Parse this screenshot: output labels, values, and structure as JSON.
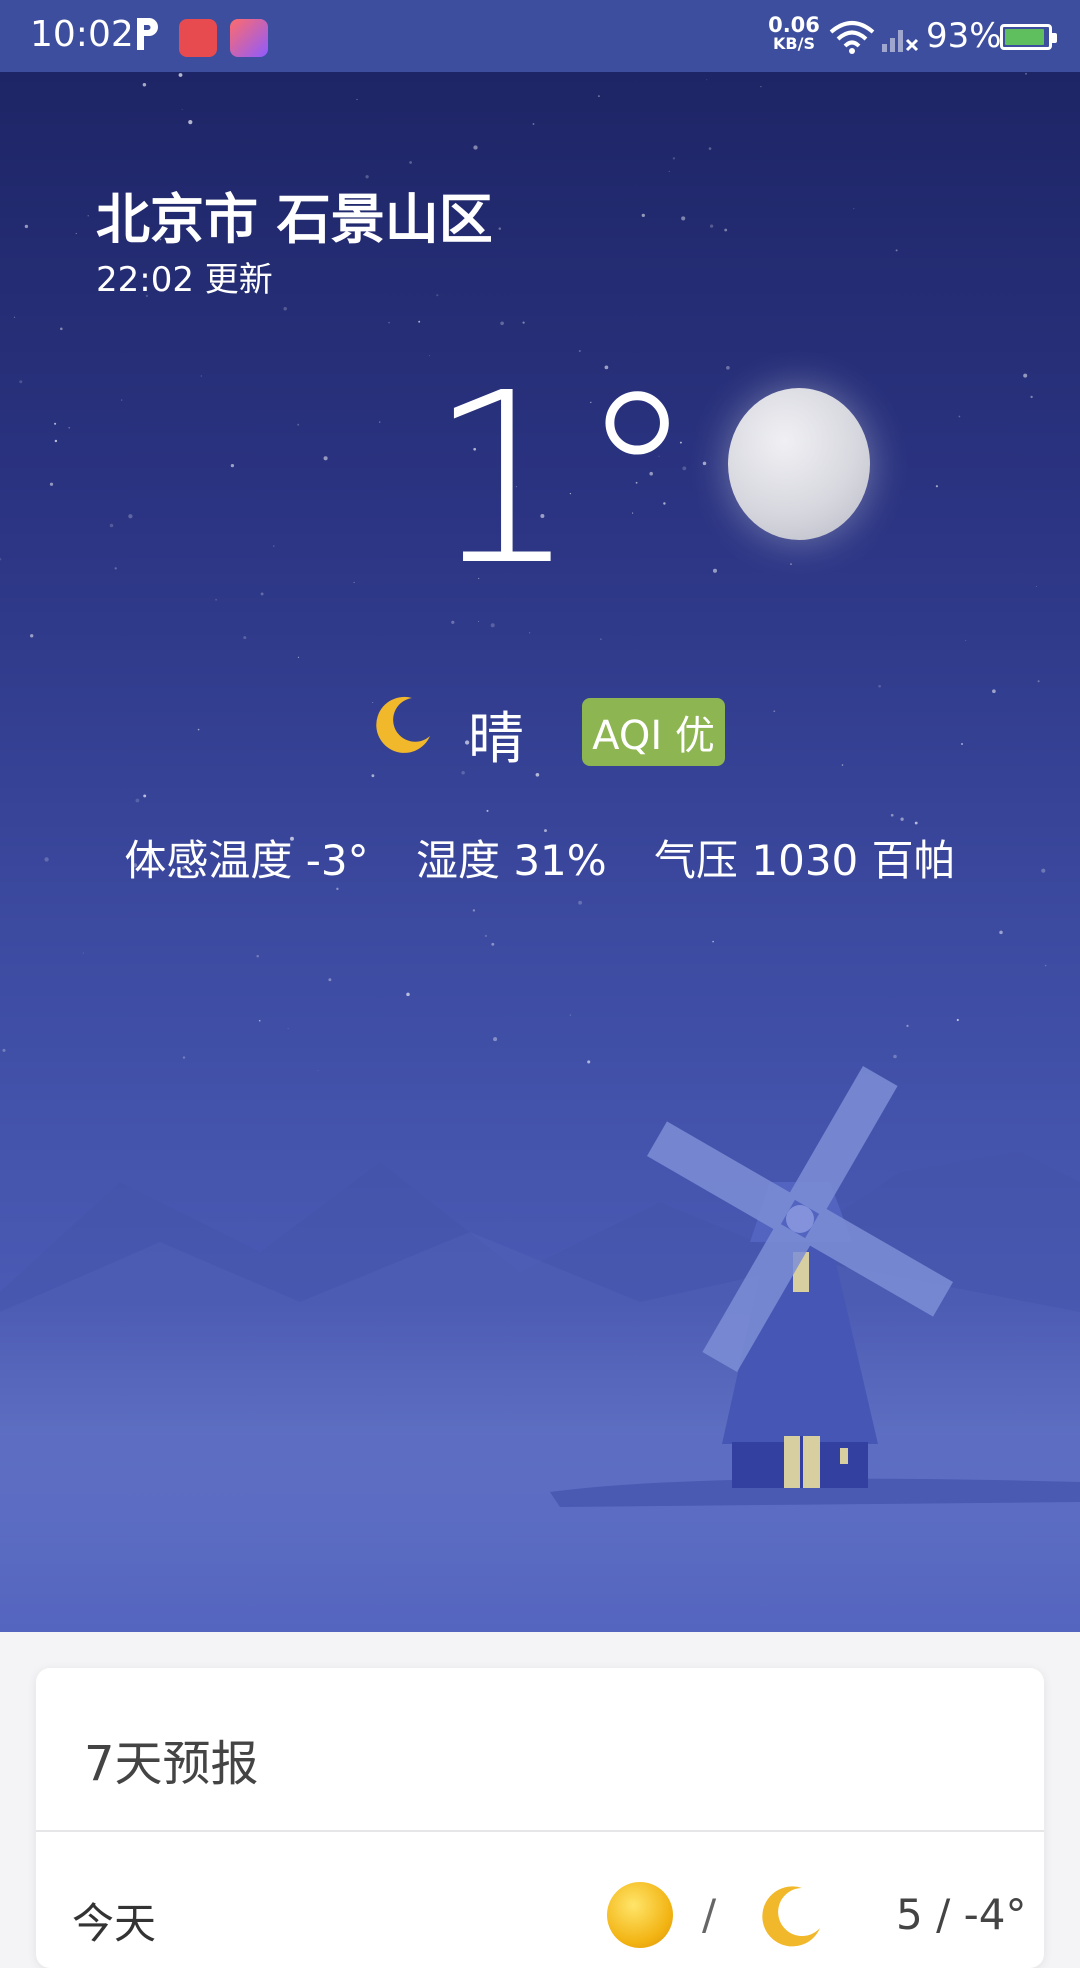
{
  "status_bar": {
    "time": "10:02",
    "net_speed_value": "0.06",
    "net_speed_unit": "KB/S",
    "battery_percent": "93%",
    "battery_level": 0.93,
    "icons": [
      "parking-icon",
      "red-app-icon",
      "paint-app-icon",
      "wifi-icon",
      "signal-icon",
      "battery-icon"
    ]
  },
  "weather": {
    "location": "北京市 石景山区",
    "updated": "22:02 更新",
    "temperature": "1°",
    "condition": "晴",
    "condition_icon": "crescent-moon-icon",
    "aqi": "AQI 优",
    "aqi_color": "#8db551",
    "feels_like": "体感温度 -3°",
    "humidity": "湿度 31%",
    "pressure": "气压 1030 百帕"
  },
  "forecast": {
    "title": "7天预报",
    "days": [
      {
        "name": "今天",
        "day_icon": "sun-icon",
        "night_icon": "crescent-moon-icon",
        "separator": "/",
        "range": "5 / -4°"
      }
    ]
  }
}
